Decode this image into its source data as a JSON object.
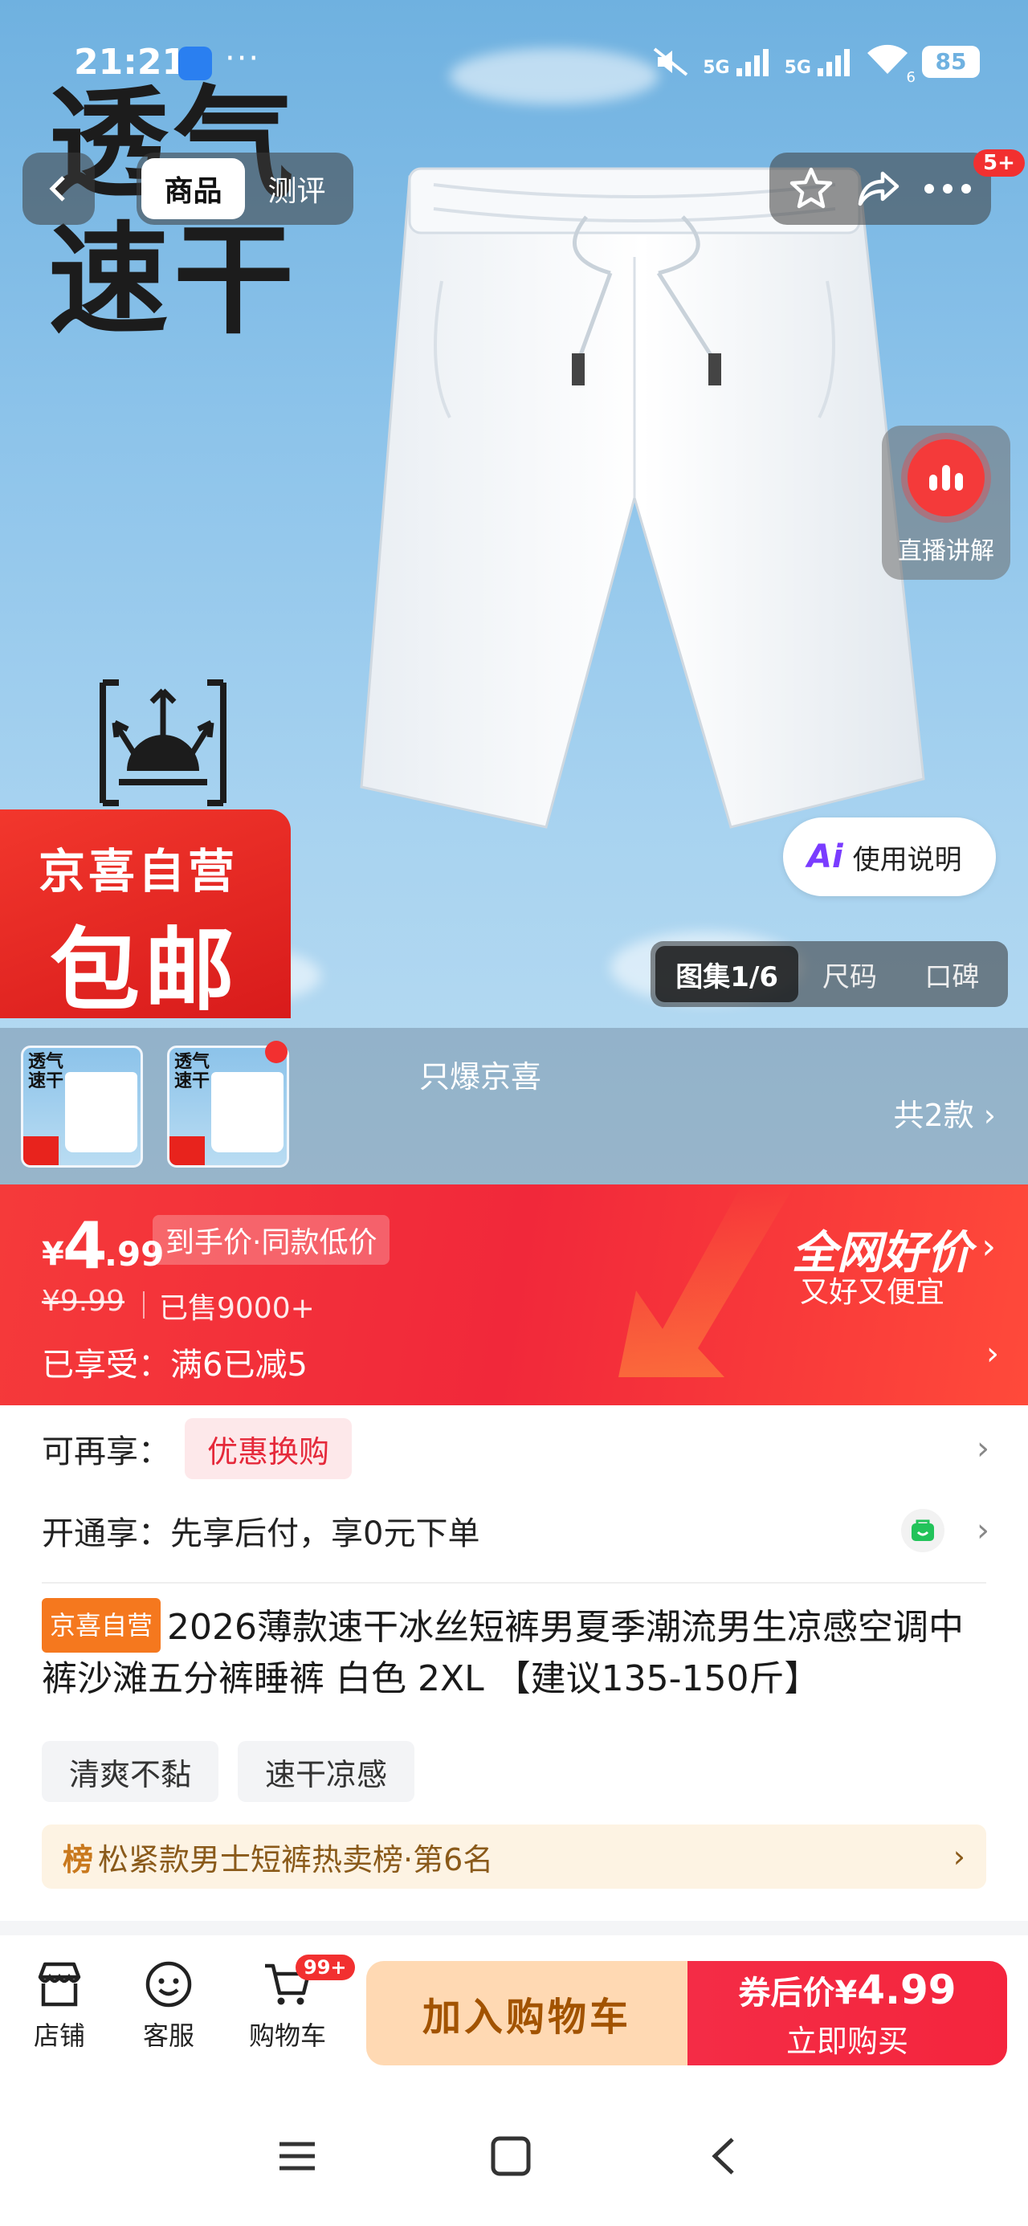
{
  "status_bar": {
    "time": "21:21",
    "dots": "···",
    "signal1": "5G",
    "signal2": "5G",
    "wifi_sub": "6",
    "battery": "85"
  },
  "hero": {
    "art_line1": "透气",
    "art_line2": "速干",
    "badge_line1": "京喜自营",
    "badge_line2": "包邮"
  },
  "nav": {
    "tabs": [
      {
        "label": "商品",
        "active": true
      },
      {
        "label": "测评",
        "active": false
      }
    ],
    "message_badge": "5+"
  },
  "live": {
    "label": "直播讲解"
  },
  "guide": {
    "ai": "Ai",
    "label": "使用说明"
  },
  "gallery_tabs": [
    {
      "label": "图集1/6",
      "active": true
    },
    {
      "label": "尺码",
      "active": false
    },
    {
      "label": "口碑",
      "active": false
    }
  ],
  "variants": {
    "thumb_text_1": "透气",
    "thumb_text_2": "速干",
    "hot_label": "只爆京喜",
    "count": "共2款"
  },
  "price": {
    "currency": "¥",
    "integer": "4",
    "decimal": ".99",
    "tag": "到手价·同款低价",
    "original": "¥9.99",
    "sold": "已售9000+",
    "promo": "已享受：满6已减5",
    "best": "全网好价",
    "best_sub": "又好又便宜"
  },
  "offers": {
    "redeem_label": "可再享：",
    "redeem_pill": "优惠换购",
    "open_label": "开通享：先享后付，享0元下单"
  },
  "product": {
    "badge": "京喜自营",
    "title": "2026薄款速干冰丝短裤男夏季潮流男生凉感空调中裤沙滩五分裤睡裤 白色 2XL 【建议135-150斤】",
    "tags": [
      "清爽不黏",
      "速干凉感"
    ],
    "rank_key": "榜",
    "rank_text": "松紧款男士短裤热卖榜·第6名"
  },
  "bottom_bar": {
    "store": "店铺",
    "service": "客服",
    "cart": "购物车",
    "cart_badge": "99+",
    "add_to_cart": "加入购物车",
    "buy_prefix": "券后价",
    "buy_currency": "¥",
    "buy_price": "4.99",
    "buy_now": "立即购买"
  },
  "colors": {
    "accent_red": "#f23030",
    "price_bar": "#f1283a",
    "cart_button": "#ffd9b3",
    "self_badge": "#f5781e"
  }
}
